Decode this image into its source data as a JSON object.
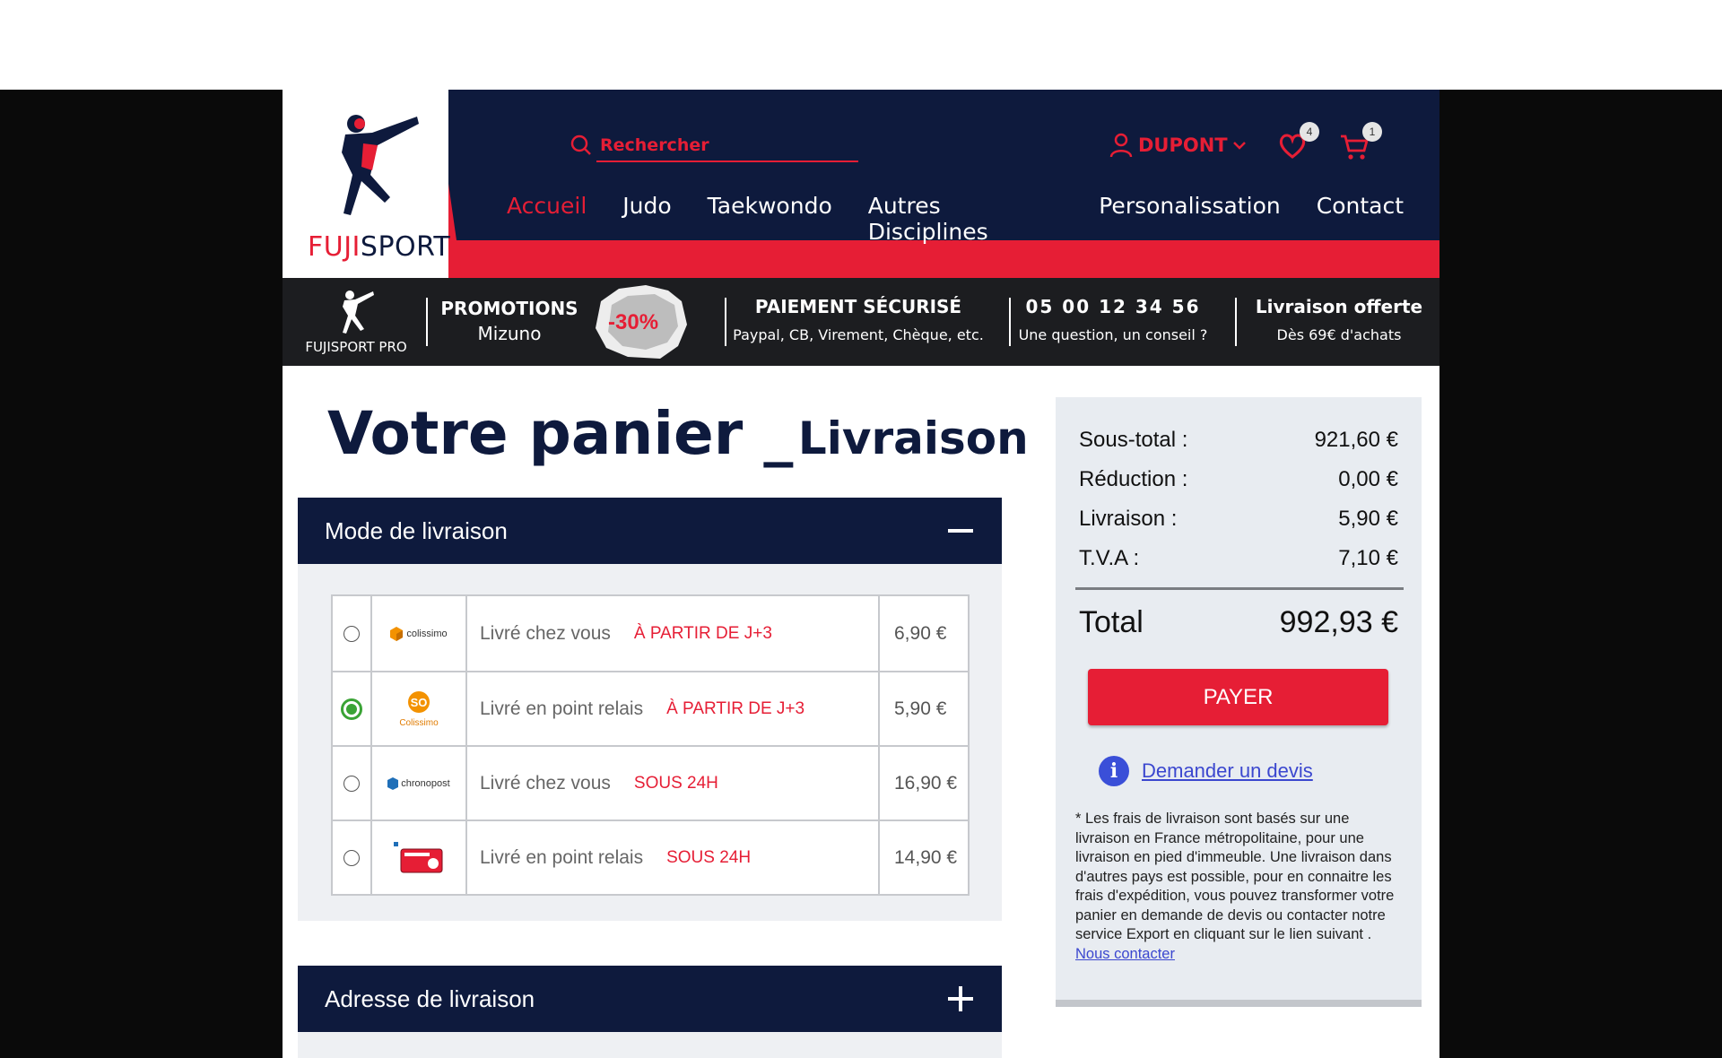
{
  "brand": {
    "name_part1": "FUJI",
    "name_part2": "SPORT"
  },
  "search": {
    "placeholder": "Rechercher"
  },
  "user": {
    "name": "DUPONT"
  },
  "wishlist": {
    "count": "4"
  },
  "cart": {
    "count": "1"
  },
  "nav": [
    "Accueil",
    "Judo",
    "Taekwondo",
    "Autres Disciplines",
    "Personalissation",
    "Contact"
  ],
  "infobar": {
    "pro_label": "FUJISPORT PRO",
    "promo_title": "PROMOTIONS",
    "promo_sub": "Mizuno",
    "promo_badge": "-30%",
    "payment_title": "PAIEMENT SÉCURISÉ",
    "payment_sub": "Paypal, CB, Virement, Chèque, etc.",
    "phone_title": "05 00 12 34 56",
    "phone_sub": "Une question, un conseil ?",
    "delivery_title": "Livraison offerte",
    "delivery_sub": "Dès 69€ d'achats"
  },
  "title": {
    "main": "Votre panier _",
    "sub": "Livraison"
  },
  "shipping_section": {
    "title": "Mode de livraison"
  },
  "shipping_options": [
    {
      "carrier": "colissimo",
      "label": "Livré chez vous",
      "delay": "À PARTIR DE J+3",
      "price": "6,90 €",
      "selected": false
    },
    {
      "carrier": "So Colissimo",
      "label": "Livré en point relais",
      "delay": "À PARTIR DE J+3",
      "price": "5,90 €",
      "selected": true
    },
    {
      "carrier": "chronopost",
      "label": "Livré chez vous",
      "delay": "SOUS 24H",
      "price": "16,90 €",
      "selected": false
    },
    {
      "carrier": "chronopost relais pickup",
      "label": "Livré en point relais",
      "delay": "SOUS 24H",
      "price": "14,90 €",
      "selected": false
    }
  ],
  "address_section": {
    "title": "Adresse de livraison"
  },
  "summary": {
    "subtotal_label": "Sous-total :",
    "subtotal": "921,60 €",
    "discount_label": "Réduction :",
    "discount": "0,00 €",
    "shipping_label": "Livraison :",
    "shipping": "5,90 €",
    "vat_label": "T.V.A :",
    "vat": "7,10 €",
    "total_label": "Total",
    "total": "992,93 €",
    "pay_label": "PAYER",
    "quote_link": "Demander un devis",
    "note": "* Les frais de livraison sont basés sur une livraison en France métropolitaine, pour une livraison en pied d'immeuble. Une livraison dans d'autres pays est possible, pour en connaitre les frais d'expédition, vous pouvez transformer votre panier en demande de devis ou contacter notre service Export en cliquant sur le lien suivant .",
    "contact_link": "Nous contacter"
  },
  "colors": {
    "navy": "#0e1a3d",
    "red": "#e61e35",
    "green": "#3aa335"
  }
}
